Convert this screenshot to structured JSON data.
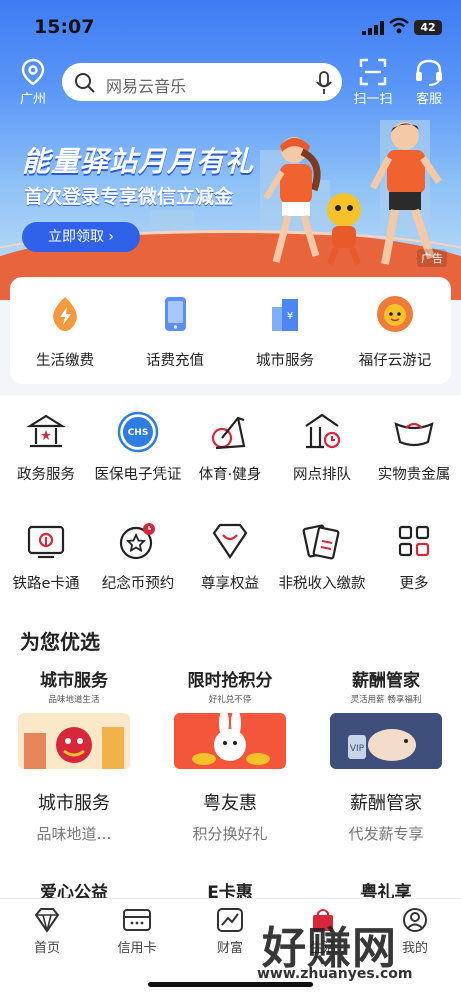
{
  "status_bar": {
    "time": "15:07",
    "battery": "42"
  },
  "top_bar": {
    "location": "广州",
    "search_placeholder": "网易云音乐",
    "scan_label": "扫一扫",
    "service_label": "客服"
  },
  "banner": {
    "title": "能量驿站月月有礼",
    "subtitle": "首次登录专享微信立减金",
    "cta": "立即领取 ›",
    "ad_tag": "广告"
  },
  "quick_services": [
    {
      "label": "生活缴费",
      "icon": "energy-icon"
    },
    {
      "label": "话费充值",
      "icon": "phone-icon"
    },
    {
      "label": "城市服务",
      "icon": "city-icon"
    },
    {
      "label": "福仔云游记",
      "icon": "mascot-icon"
    }
  ],
  "service_grid": [
    {
      "label": "政务服务",
      "icon": "government-icon"
    },
    {
      "label": "医保电子凭证",
      "icon": "chs-icon",
      "badge": "CHS"
    },
    {
      "label": "体育·健身",
      "icon": "fitness-icon"
    },
    {
      "label": "网点排队",
      "icon": "branch-queue-icon"
    },
    {
      "label": "实物贵金属",
      "icon": "gold-ingot-icon"
    },
    {
      "label": "铁路e卡通",
      "icon": "railway-card-icon"
    },
    {
      "label": "纪念币预约",
      "icon": "coin-icon"
    },
    {
      "label": "尊享权益",
      "icon": "diamond-icon"
    },
    {
      "label": "非税收入缴款",
      "icon": "tax-payment-icon"
    },
    {
      "label": "更多",
      "icon": "more-grid-icon"
    }
  ],
  "recommend": {
    "title": "为您优选",
    "cards": [
      {
        "head": "城市服务",
        "tag": "品味地道生活",
        "name": "城市服务",
        "desc": "品味地道…"
      },
      {
        "head": "限时抢积分",
        "tag": "好礼兑不停",
        "name": "粤友惠",
        "desc": "积分换好礼"
      },
      {
        "head": "薪酬管家",
        "tag": "灵活用薪  畅享福利",
        "name": "薪酬管家",
        "desc": "代发薪专享"
      }
    ],
    "more_cards": [
      "爱心公益",
      "E卡惠",
      "粤礼享"
    ]
  },
  "tabbar": {
    "items": [
      {
        "label": "首页",
        "icon": "diamond-home-icon"
      },
      {
        "label": "信用卡",
        "icon": "credit-card-icon"
      },
      {
        "label": "财富",
        "icon": "wealth-chart-icon"
      },
      {
        "label": "生活",
        "icon": "shopping-bag-icon"
      },
      {
        "label": "我的",
        "icon": "profile-icon"
      }
    ]
  },
  "watermark": {
    "text": "好赚网",
    "url": "www.zhuanyes.com"
  },
  "colors": {
    "primary": "#3e7cf4",
    "accent": "#e8643d",
    "red": "#d6273b"
  }
}
